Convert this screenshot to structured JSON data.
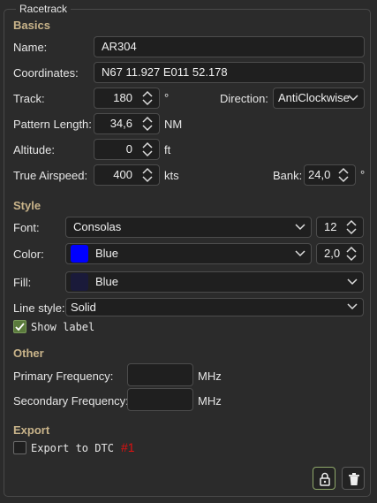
{
  "group_title": "Racetrack",
  "basics": {
    "header": "Basics",
    "name_label": "Name:",
    "name_value": "AR304",
    "coords_label": "Coordinates:",
    "coords_value": "N67 11.927 E011 52.178",
    "track_label": "Track:",
    "track_value": "180",
    "track_unit": "°",
    "direction_label": "Direction:",
    "direction_value": "AntiClockwise",
    "pattern_label": "Pattern Length:",
    "pattern_value": "34,6",
    "pattern_unit": "NM",
    "altitude_label": "Altitude:",
    "altitude_value": "0",
    "altitude_unit": "ft",
    "tas_label": "True Airspeed:",
    "tas_value": "400",
    "tas_unit": "kts",
    "bank_label": "Bank:",
    "bank_value": "24,0",
    "bank_unit": "°"
  },
  "style": {
    "header": "Style",
    "font_label": "Font:",
    "font_value": "Consolas",
    "font_size_value": "12",
    "color_label": "Color:",
    "color_value": "Blue",
    "color_swatch": "#0000ff",
    "line_width_value": "2,0",
    "fill_label": "Fill:",
    "fill_value": "Blue",
    "fill_swatch": "#1a1a3a",
    "line_style_label": "Line style:",
    "line_style_value": "Solid",
    "show_label_text": "Show label",
    "show_label_checked": true
  },
  "other": {
    "header": "Other",
    "primary_label": "Primary Frequency:",
    "primary_value": "",
    "primary_unit": "MHz",
    "secondary_label": "Secondary Frequency:",
    "secondary_value": "",
    "secondary_unit": "MHz"
  },
  "export": {
    "header": "Export",
    "export_dtc_text": "Export to DTC",
    "export_dtc_checked": false,
    "export_tag": "#1",
    "export_tag_color": "#e01010"
  },
  "toolbar": {
    "lock_icon": "lock-icon",
    "delete_icon": "trash-icon"
  }
}
